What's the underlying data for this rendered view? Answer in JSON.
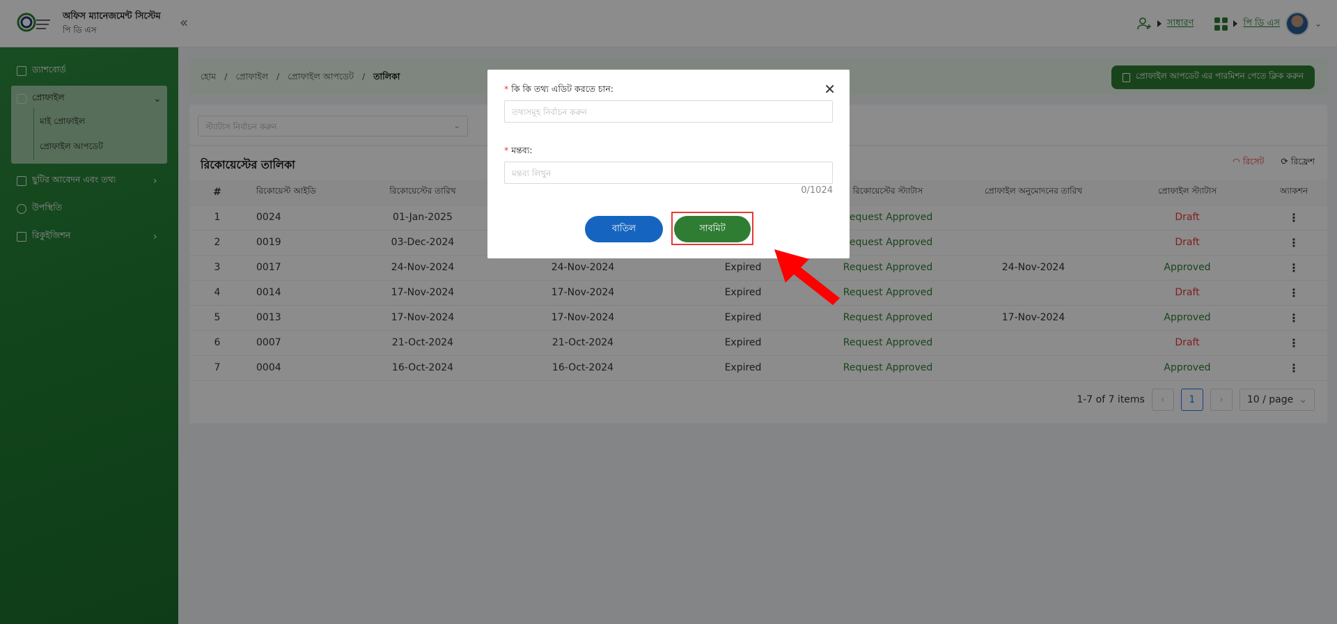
{
  "header": {
    "title": "অফিস ম্যানেজমেন্ট সিস্টেম",
    "subtitle": "পি ডি এস",
    "role_link": "সাধারণ",
    "app_link": "পি ডি এস"
  },
  "sidebar": {
    "items": [
      {
        "label": "ড্যাশবোর্ড"
      },
      {
        "label": "প্রোফাইল"
      },
      {
        "label": "ছুটির আবেদন এবং তথ্য"
      },
      {
        "label": "উপস্থিতি"
      },
      {
        "label": "রিকুইজিশন"
      }
    ],
    "sub_items": [
      {
        "label": "মাই প্রোফাইল"
      },
      {
        "label": "প্রোফাইল আপডেট"
      }
    ]
  },
  "breadcrumb": [
    "হোম",
    "প্রোফাইল",
    "প্রোফাইল আপডেট",
    "তালিকা"
  ],
  "permission_button": "প্রোফাইল আপডেট এর পারমিশন পেতে ক্লিক করুন",
  "filter": {
    "status_placeholder": "স্ট্যাটাস নির্বাচন করুন"
  },
  "table": {
    "title": "রিকোয়েস্টের তালিকা",
    "reset": "রিসেট",
    "refresh": "রিফ্রেশ",
    "columns": [
      "#",
      "রিকোয়েস্ট আইডি",
      "রিকোয়েস্টের তারিখ",
      "",
      "",
      "রিকোয়েস্টের স্ট্যাটাস",
      "প্রোফাইল অনুমোদনের তারিখ",
      "প্রোফাইল স্ট্যাটাস",
      "অ্যাকশন"
    ],
    "rows": [
      {
        "n": "1",
        "id": "0024",
        "req_date": "01-Jan-2025",
        "exp_date": "",
        "state": "",
        "req_status": "Request Approved",
        "appr_date": "",
        "prof_status": "Draft"
      },
      {
        "n": "2",
        "id": "0019",
        "req_date": "03-Dec-2024",
        "exp_date": "",
        "state": "",
        "req_status": "Request Approved",
        "appr_date": "",
        "prof_status": "Draft"
      },
      {
        "n": "3",
        "id": "0017",
        "req_date": "24-Nov-2024",
        "exp_date": "24-Nov-2024",
        "state": "Expired",
        "req_status": "Request Approved",
        "appr_date": "24-Nov-2024",
        "prof_status": "Approved"
      },
      {
        "n": "4",
        "id": "0014",
        "req_date": "17-Nov-2024",
        "exp_date": "17-Nov-2024",
        "state": "Expired",
        "req_status": "Request Approved",
        "appr_date": "",
        "prof_status": "Draft"
      },
      {
        "n": "5",
        "id": "0013",
        "req_date": "17-Nov-2024",
        "exp_date": "17-Nov-2024",
        "state": "Expired",
        "req_status": "Request Approved",
        "appr_date": "17-Nov-2024",
        "prof_status": "Approved"
      },
      {
        "n": "6",
        "id": "0007",
        "req_date": "21-Oct-2024",
        "exp_date": "21-Oct-2024",
        "state": "Expired",
        "req_status": "Request Approved",
        "appr_date": "",
        "prof_status": "Draft"
      },
      {
        "n": "7",
        "id": "0004",
        "req_date": "16-Oct-2024",
        "exp_date": "16-Oct-2024",
        "state": "Expired",
        "req_status": "Request Approved",
        "appr_date": "",
        "prof_status": "Approved"
      }
    ]
  },
  "pagination": {
    "summary": "1-7 of 7 items",
    "current": "1",
    "page_size": "10 / page"
  },
  "modal": {
    "field1_label": "কি কি তথ্য এডিট করতে চান:",
    "field1_placeholder": "তথ্যসমূহ নির্বাচন করুন",
    "field2_label": "মন্তব্য:",
    "field2_placeholder": "মন্তব্য লিখুন",
    "char_count": "0/1024",
    "cancel": "বাতিল",
    "submit": "সাবমিট"
  },
  "colors": {
    "brand": "#2e7d32",
    "cancel": "#1565c0",
    "highlight": "#e53935"
  },
  "icons": [
    "logo-icon",
    "collapse-icon",
    "user-switch-icon",
    "apps-grid-icon",
    "close-icon",
    "refresh-icon",
    "reset-icon",
    "kebab-menu-icon"
  ]
}
